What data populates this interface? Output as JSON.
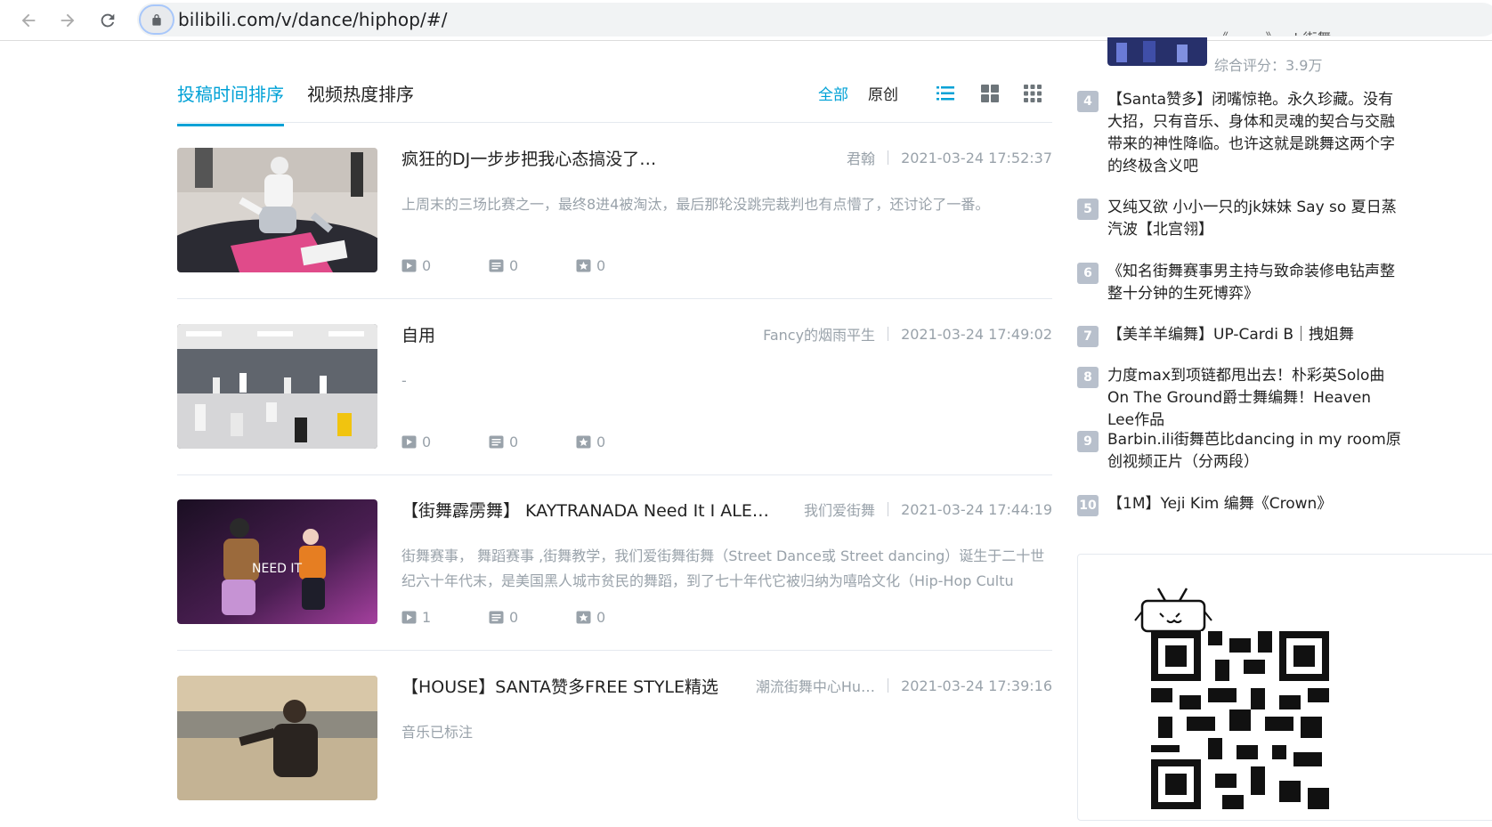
{
  "browser": {
    "url": "bilibili.com/v/dance/hiphop/#/"
  },
  "tabs": {
    "time_sort": "投稿时间排序",
    "hot_sort": "视频热度排序",
    "filter_all": "全部",
    "filter_original": "原创"
  },
  "videos": [
    {
      "title": "疯狂的DJ一步步把我心态搞没了…",
      "author": "君翰",
      "time": "2021-03-24 17:52:37",
      "desc": "上周末的三场比赛之一，最终8进4被淘汰，最后那轮没跳完裁判也有点懵了，还讨论了一番。",
      "plays": "0",
      "danmaku": "0",
      "favorites": "0"
    },
    {
      "title": "自用",
      "author": "Fancy的烟雨平生",
      "time": "2021-03-24 17:49:02",
      "desc": "-",
      "plays": "0",
      "danmaku": "0",
      "favorites": "0"
    },
    {
      "title": "【街舞霹雳舞】 KAYTRANADA Need It I ALE…",
      "author": "我们爱街舞",
      "time": "2021-03-24 17:44:19",
      "desc": "街舞赛事， 舞蹈赛事 ,街舞教学，我们爱街舞街舞（Street Dance或 Street dancing）诞生于二十世纪六十年代末，是美国黑人城市贫民的舞蹈，到了七十年代它被归纳为嘻哈文化（Hip-Hop Cultu",
      "plays": "1",
      "danmaku": "0",
      "favorites": "0",
      "thumb_caption": "NEED IT"
    },
    {
      "title": "【HOUSE】SANTA赞多FREE STYLE精选",
      "author": "潮流街舞中心Hu…",
      "time": "2021-03-24 17:39:16",
      "desc": "音乐已标注",
      "plays": "",
      "danmaku": "",
      "favorites": ""
    }
  ],
  "rank": {
    "partial_title": "《……y》…b街舞…",
    "partial_score": "综合评分：3.9万",
    "items": [
      {
        "num": "4",
        "title": "【Santa赞多】闭嘴惊艳。永久珍藏。没有大招，只有音乐、身体和灵魂的契合与交融带来的神性降临。也许这就是跳舞这两个字的终极含义吧"
      },
      {
        "num": "5",
        "title": "又纯又欲 小小一只的jk妹妹 Say so 夏日蒸汽波【北宫翎】"
      },
      {
        "num": "6",
        "title": "《知名街舞赛事男主持与致命装修电钻声整整十分钟的生死博弈》"
      },
      {
        "num": "7",
        "title": "【美羊羊编舞】UP-Cardi B｜拽姐舞"
      },
      {
        "num": "8",
        "title": "力度max到项链都甩出去！朴彩英Solo曲On The Ground爵士舞编舞！Heaven Lee作品"
      },
      {
        "num": "9",
        "title": "Barbin.ili街舞芭比dancing in my room原创视频正片（分两段）"
      },
      {
        "num": "10",
        "title": "【1M】Yeji Kim 编舞《Crown》"
      }
    ]
  },
  "colors": {
    "accent": "#00a1d6",
    "muted": "#99a2aa",
    "rank_badge": "#b8c0cc"
  }
}
